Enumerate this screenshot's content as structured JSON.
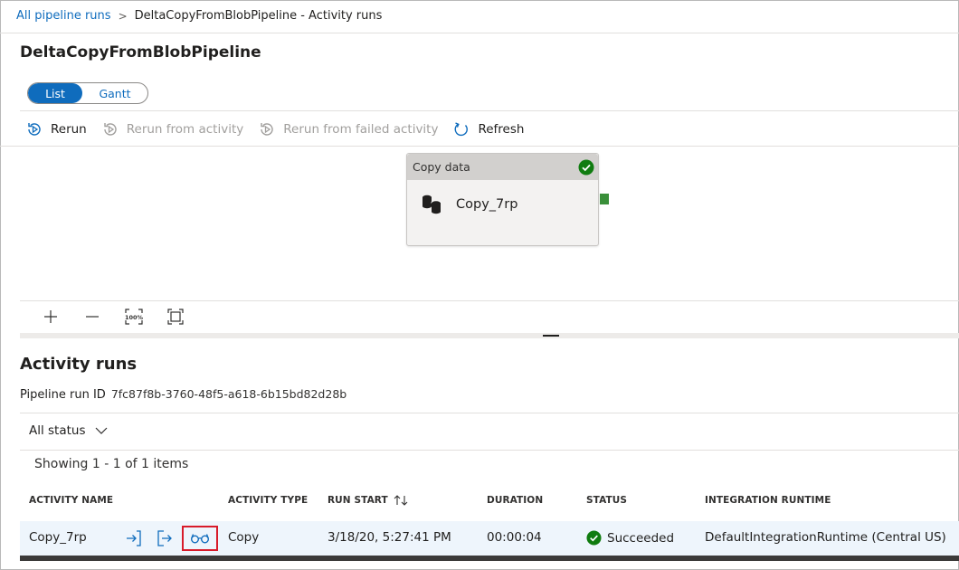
{
  "breadcrumb": {
    "root": "All pipeline runs",
    "separator": ">",
    "current": "DeltaCopyFromBlobPipeline - Activity runs"
  },
  "pipeline": {
    "title": "DeltaCopyFromBlobPipeline"
  },
  "view_toggle": {
    "list": "List",
    "gantt": "Gantt",
    "selected": "List"
  },
  "toolbar": {
    "rerun": "Rerun",
    "rerun_from_activity": "Rerun from activity",
    "rerun_from_failed": "Rerun from failed activity",
    "refresh": "Refresh"
  },
  "canvas": {
    "node": {
      "type": "Copy data",
      "name": "Copy_7rp",
      "status_icon": "check-circle-icon"
    },
    "zoom": {
      "fit_label": "100%"
    }
  },
  "activity_runs": {
    "title": "Activity runs",
    "run_id_label": "Pipeline run ID",
    "run_id": "7fc87f8b-3760-48f5-a618-6b15bd82d28b",
    "filter": "All status",
    "showing": "Showing 1 - 1 of 1 items",
    "columns": {
      "name": "ACTIVITY NAME",
      "type": "ACTIVITY TYPE",
      "start": "RUN START",
      "duration": "DURATION",
      "status": "STATUS",
      "runtime": "INTEGRATION RUNTIME"
    },
    "rows": [
      {
        "name": "Copy_7rp",
        "type": "Copy",
        "start": "3/18/20, 5:27:41 PM",
        "duration": "00:00:04",
        "status": "Succeeded",
        "runtime": "DefaultIntegrationRuntime (Central US)"
      }
    ]
  },
  "colors": {
    "accent": "#0f6cbd",
    "success": "#107c10",
    "highlight": "#d81b2a"
  }
}
